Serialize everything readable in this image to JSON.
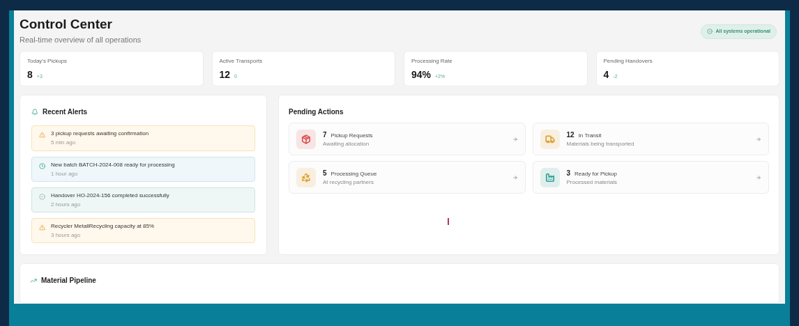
{
  "header": {
    "title": "Control Center",
    "subtitle": "Real-time overview of all operations",
    "status_badge": "All systems operational"
  },
  "stats": [
    {
      "label": "Today's Pickups",
      "value": "8",
      "delta": "+3"
    },
    {
      "label": "Active Transports",
      "value": "12",
      "delta": "0"
    },
    {
      "label": "Processing Rate",
      "value": "94%",
      "delta": "+2%"
    },
    {
      "label": "Pending Handovers",
      "value": "4",
      "delta": "-2"
    }
  ],
  "recent_alerts": {
    "title": "Recent Alerts",
    "items": [
      {
        "kind": "warning",
        "message": "3 pickup requests awaiting confirmation",
        "time": "5 min ago"
      },
      {
        "kind": "info",
        "message": "New batch BATCH-2024-008 ready for processing",
        "time": "1 hour ago"
      },
      {
        "kind": "success",
        "message": "Handover HO-2024-156 completed successfully",
        "time": "2 hours ago"
      },
      {
        "kind": "warning",
        "message": "Recycler MetallRecycling capacity at 85%",
        "time": "3 hours ago"
      }
    ]
  },
  "pending_actions": {
    "title": "Pending Actions",
    "items": [
      {
        "kind": "package",
        "count": "7",
        "label": "Pickup Requests",
        "sublabel": "Awaiting allocation",
        "color": "#dc4b4b"
      },
      {
        "kind": "truck",
        "count": "12",
        "label": "In Transit",
        "sublabel": "Materials being transported",
        "color": "#e0a030"
      },
      {
        "kind": "recycle",
        "count": "5",
        "label": "Processing Queue",
        "sublabel": "At recycling partners",
        "color": "#e0a030"
      },
      {
        "kind": "factory",
        "count": "3",
        "label": "Ready for Pickup",
        "sublabel": "Processed materials",
        "color": "#2a9d8f"
      }
    ]
  },
  "material_pipeline": {
    "title": "Material Pipeline"
  }
}
